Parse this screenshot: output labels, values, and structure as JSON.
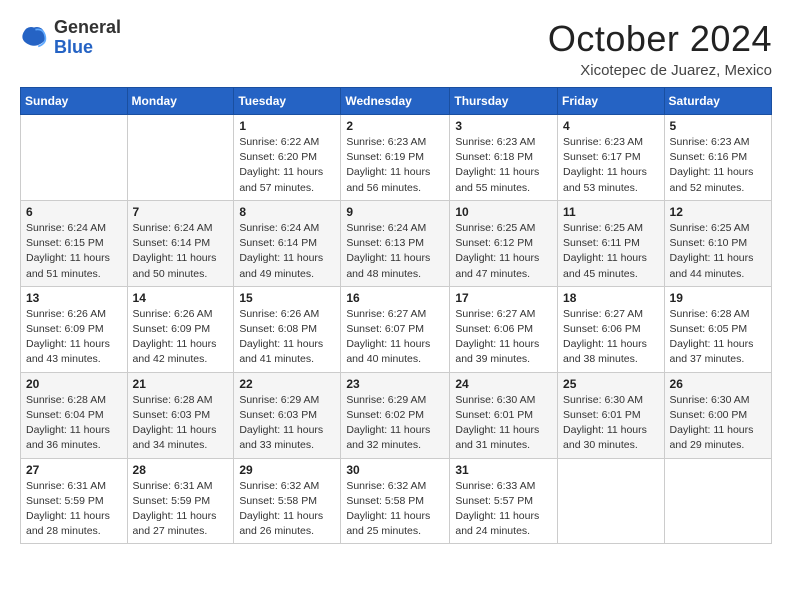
{
  "logo": {
    "general": "General",
    "blue": "Blue"
  },
  "title": "October 2024",
  "location": "Xicotepec de Juarez, Mexico",
  "days_header": [
    "Sunday",
    "Monday",
    "Tuesday",
    "Wednesday",
    "Thursday",
    "Friday",
    "Saturday"
  ],
  "weeks": [
    [
      {
        "day": "",
        "info": ""
      },
      {
        "day": "",
        "info": ""
      },
      {
        "day": "1",
        "info": "Sunrise: 6:22 AM\nSunset: 6:20 PM\nDaylight: 11 hours and 57 minutes."
      },
      {
        "day": "2",
        "info": "Sunrise: 6:23 AM\nSunset: 6:19 PM\nDaylight: 11 hours and 56 minutes."
      },
      {
        "day": "3",
        "info": "Sunrise: 6:23 AM\nSunset: 6:18 PM\nDaylight: 11 hours and 55 minutes."
      },
      {
        "day": "4",
        "info": "Sunrise: 6:23 AM\nSunset: 6:17 PM\nDaylight: 11 hours and 53 minutes."
      },
      {
        "day": "5",
        "info": "Sunrise: 6:23 AM\nSunset: 6:16 PM\nDaylight: 11 hours and 52 minutes."
      }
    ],
    [
      {
        "day": "6",
        "info": "Sunrise: 6:24 AM\nSunset: 6:15 PM\nDaylight: 11 hours and 51 minutes."
      },
      {
        "day": "7",
        "info": "Sunrise: 6:24 AM\nSunset: 6:14 PM\nDaylight: 11 hours and 50 minutes."
      },
      {
        "day": "8",
        "info": "Sunrise: 6:24 AM\nSunset: 6:14 PM\nDaylight: 11 hours and 49 minutes."
      },
      {
        "day": "9",
        "info": "Sunrise: 6:24 AM\nSunset: 6:13 PM\nDaylight: 11 hours and 48 minutes."
      },
      {
        "day": "10",
        "info": "Sunrise: 6:25 AM\nSunset: 6:12 PM\nDaylight: 11 hours and 47 minutes."
      },
      {
        "day": "11",
        "info": "Sunrise: 6:25 AM\nSunset: 6:11 PM\nDaylight: 11 hours and 45 minutes."
      },
      {
        "day": "12",
        "info": "Sunrise: 6:25 AM\nSunset: 6:10 PM\nDaylight: 11 hours and 44 minutes."
      }
    ],
    [
      {
        "day": "13",
        "info": "Sunrise: 6:26 AM\nSunset: 6:09 PM\nDaylight: 11 hours and 43 minutes."
      },
      {
        "day": "14",
        "info": "Sunrise: 6:26 AM\nSunset: 6:09 PM\nDaylight: 11 hours and 42 minutes."
      },
      {
        "day": "15",
        "info": "Sunrise: 6:26 AM\nSunset: 6:08 PM\nDaylight: 11 hours and 41 minutes."
      },
      {
        "day": "16",
        "info": "Sunrise: 6:27 AM\nSunset: 6:07 PM\nDaylight: 11 hours and 40 minutes."
      },
      {
        "day": "17",
        "info": "Sunrise: 6:27 AM\nSunset: 6:06 PM\nDaylight: 11 hours and 39 minutes."
      },
      {
        "day": "18",
        "info": "Sunrise: 6:27 AM\nSunset: 6:06 PM\nDaylight: 11 hours and 38 minutes."
      },
      {
        "day": "19",
        "info": "Sunrise: 6:28 AM\nSunset: 6:05 PM\nDaylight: 11 hours and 37 minutes."
      }
    ],
    [
      {
        "day": "20",
        "info": "Sunrise: 6:28 AM\nSunset: 6:04 PM\nDaylight: 11 hours and 36 minutes."
      },
      {
        "day": "21",
        "info": "Sunrise: 6:28 AM\nSunset: 6:03 PM\nDaylight: 11 hours and 34 minutes."
      },
      {
        "day": "22",
        "info": "Sunrise: 6:29 AM\nSunset: 6:03 PM\nDaylight: 11 hours and 33 minutes."
      },
      {
        "day": "23",
        "info": "Sunrise: 6:29 AM\nSunset: 6:02 PM\nDaylight: 11 hours and 32 minutes."
      },
      {
        "day": "24",
        "info": "Sunrise: 6:30 AM\nSunset: 6:01 PM\nDaylight: 11 hours and 31 minutes."
      },
      {
        "day": "25",
        "info": "Sunrise: 6:30 AM\nSunset: 6:01 PM\nDaylight: 11 hours and 30 minutes."
      },
      {
        "day": "26",
        "info": "Sunrise: 6:30 AM\nSunset: 6:00 PM\nDaylight: 11 hours and 29 minutes."
      }
    ],
    [
      {
        "day": "27",
        "info": "Sunrise: 6:31 AM\nSunset: 5:59 PM\nDaylight: 11 hours and 28 minutes."
      },
      {
        "day": "28",
        "info": "Sunrise: 6:31 AM\nSunset: 5:59 PM\nDaylight: 11 hours and 27 minutes."
      },
      {
        "day": "29",
        "info": "Sunrise: 6:32 AM\nSunset: 5:58 PM\nDaylight: 11 hours and 26 minutes."
      },
      {
        "day": "30",
        "info": "Sunrise: 6:32 AM\nSunset: 5:58 PM\nDaylight: 11 hours and 25 minutes."
      },
      {
        "day": "31",
        "info": "Sunrise: 6:33 AM\nSunset: 5:57 PM\nDaylight: 11 hours and 24 minutes."
      },
      {
        "day": "",
        "info": ""
      },
      {
        "day": "",
        "info": ""
      }
    ]
  ]
}
